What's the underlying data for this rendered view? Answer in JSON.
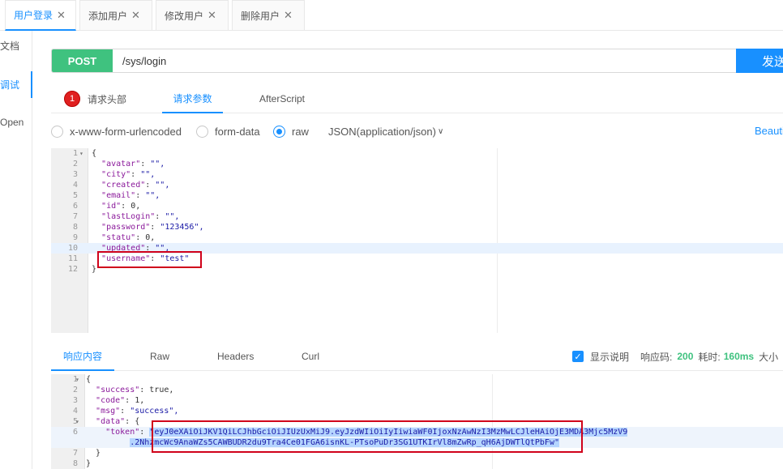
{
  "tabs": [
    {
      "label": "用户登录",
      "close": "✕"
    },
    {
      "label": "添加用户",
      "close": "✕"
    },
    {
      "label": "修改用户",
      "close": "✕"
    },
    {
      "label": "删除用户",
      "close": "✕"
    }
  ],
  "sidebar": {
    "items": [
      {
        "label": "文档"
      },
      {
        "label": "调试"
      },
      {
        "label": "Open"
      }
    ]
  },
  "request": {
    "method": "POST",
    "url": "/sys/login",
    "send_label": "发送"
  },
  "request_tabs": {
    "headers_badge": "1",
    "headers": "请求头部",
    "params": "请求参数",
    "afterscript": "AfterScript"
  },
  "body_types": {
    "urlencoded": "x-www-form-urlencoded",
    "formdata": "form-data",
    "raw": "raw",
    "json_select": "JSON(application/json)",
    "beautify": "Beautify"
  },
  "request_body": {
    "line_numbers": [
      "1",
      "2",
      "3",
      "4",
      "5",
      "6",
      "7",
      "8",
      "9",
      "10",
      "11",
      "12"
    ],
    "lines": [
      {
        "t": "{"
      },
      {
        "k": "\"avatar\"",
        "v": "\"\","
      },
      {
        "k": "\"city\"",
        "v": "\"\","
      },
      {
        "k": "\"created\"",
        "v": "\"\","
      },
      {
        "k": "\"email\"",
        "v": "\"\","
      },
      {
        "k": "\"id\"",
        "v": "0,"
      },
      {
        "k": "\"lastLogin\"",
        "v": "\"\","
      },
      {
        "k": "\"password\"",
        "v": "\"123456\","
      },
      {
        "k": "\"statu\"",
        "v": "0,"
      },
      {
        "k": "\"updated\"",
        "v": "\"\","
      },
      {
        "k": "\"username\"",
        "v": "\"test\""
      },
      {
        "t": "}"
      }
    ]
  },
  "response_tabs": {
    "content": "响应内容",
    "raw": "Raw",
    "headers": "Headers",
    "curl": "Curl"
  },
  "response_meta": {
    "show_desc": "显示说明",
    "code_label": "响应码:",
    "code": "200",
    "time_label": "耗时:",
    "time": "160ms",
    "size_label": "大小"
  },
  "response_body": {
    "line_numbers": [
      "1",
      "2",
      "3",
      "4",
      "5",
      "6",
      "",
      "7",
      "8"
    ],
    "lines": [
      {
        "t": "{"
      },
      {
        "k": "\"success\"",
        "v": "true,"
      },
      {
        "k": "\"code\"",
        "v": "1,"
      },
      {
        "k": "\"msg\"",
        "v": "\"success\","
      },
      {
        "k": "\"data\"",
        "v": "{"
      },
      {
        "k": "\"token\"",
        "v": "\"eyJ0eXAiOiJKV1QiLCJhbGciOiJIUzUxMiJ9.eyJzdWIiOiIyIiwiaWF0IjoxNzAwNzI3MzMwLCJleHAiOjE3MDA3Mjc5MzV9"
      },
      {
        "t": ".2NhzmcWc9AnaWZs5CAWBUDR2du9Tra4Ce01FGA6isnKL-PTsoPuDr3SG1UTKIrVl8mZwRp_qH6AjDWTlQtPbFw\""
      },
      {
        "t": "}"
      },
      {
        "t": "}"
      }
    ]
  }
}
